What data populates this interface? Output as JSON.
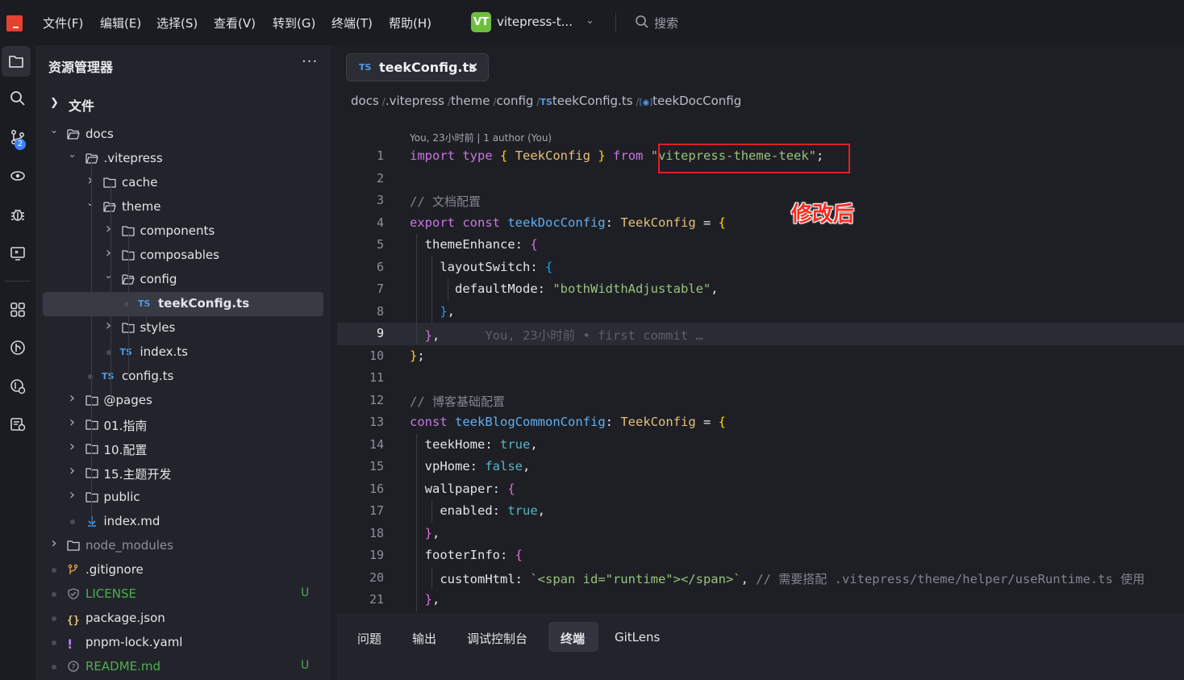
{
  "menubar": {
    "items": [
      "文件(F)",
      "编辑(E)",
      "选择(S)",
      "查看(V)",
      "转到(G)",
      "终端(T)",
      "帮助(H)"
    ],
    "project_badge": "VT",
    "project_name": "vitepress-t...",
    "search_placeholder": "搜索"
  },
  "activity": {
    "scm_badge": "2"
  },
  "explorer": {
    "title": "资源管理器",
    "more": "···",
    "section": "文件",
    "tree": [
      {
        "label": "docs",
        "type": "folder-open",
        "depth": 0
      },
      {
        "label": ".vitepress",
        "type": "folder-open",
        "depth": 1
      },
      {
        "label": "cache",
        "type": "folder",
        "depth": 2
      },
      {
        "label": "theme",
        "type": "folder-open",
        "depth": 2
      },
      {
        "label": "components",
        "type": "folder",
        "depth": 3
      },
      {
        "label": "composables",
        "type": "folder",
        "depth": 3
      },
      {
        "label": "config",
        "type": "folder-open",
        "depth": 3
      },
      {
        "label": "teekConfig.ts",
        "type": "ts",
        "depth": 4,
        "selected": true
      },
      {
        "label": "styles",
        "type": "folder",
        "depth": 3
      },
      {
        "label": "index.ts",
        "type": "ts",
        "depth": 3
      },
      {
        "label": "config.ts",
        "type": "ts",
        "depth": 2
      },
      {
        "label": "@pages",
        "type": "folder",
        "depth": 1
      },
      {
        "label": "01.指南",
        "type": "folder",
        "depth": 1
      },
      {
        "label": "10.配置",
        "type": "folder",
        "depth": 1
      },
      {
        "label": "15.主题开发",
        "type": "folder",
        "depth": 1
      },
      {
        "label": "public",
        "type": "folder",
        "depth": 1
      },
      {
        "label": "index.md",
        "type": "md",
        "depth": 1
      },
      {
        "label": "node_modules",
        "type": "folder",
        "depth": 0,
        "dim": true
      },
      {
        "label": ".gitignore",
        "type": "git",
        "depth": 0
      },
      {
        "label": "LICENSE",
        "type": "license",
        "depth": 0,
        "status": "U"
      },
      {
        "label": "package.json",
        "type": "json",
        "depth": 0
      },
      {
        "label": "pnpm-lock.yaml",
        "type": "yaml",
        "depth": 0
      },
      {
        "label": "README.md",
        "type": "readme",
        "depth": 0,
        "status": "U"
      }
    ]
  },
  "editor": {
    "tab_badge": "TS",
    "tab_label": "teekConfig.ts",
    "tab_close": "×",
    "breadcrumb": [
      "docs",
      ".vitepress",
      "theme",
      "config",
      "teekConfig.ts",
      "teekDocConfig"
    ],
    "blame_header": "You, 23小时前 | 1 author (You)",
    "current_line": 9,
    "annotation": "修改后",
    "lines": [
      "1",
      "2",
      "3",
      "4",
      "5",
      "6",
      "7",
      "8",
      "9",
      "10",
      "11",
      "12",
      "13",
      "14",
      "15",
      "16",
      "17",
      "18",
      "19",
      "20",
      "21"
    ],
    "inline_blame": "You, 23小时前 • first commit …"
  },
  "panel": {
    "tabs": [
      "问题",
      "输出",
      "调试控制台",
      "终端",
      "GitLens"
    ],
    "active_tab": "终端"
  }
}
